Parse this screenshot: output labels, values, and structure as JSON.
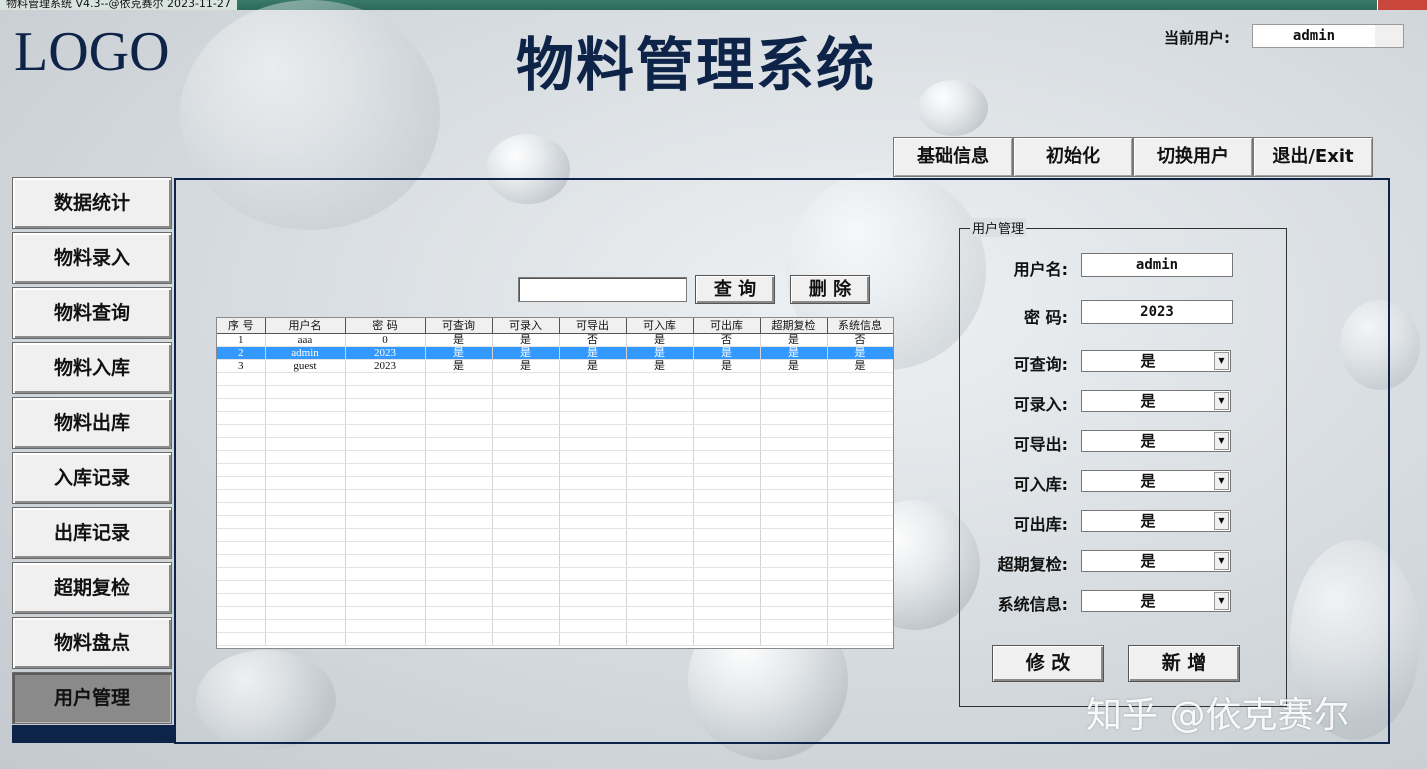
{
  "window": {
    "title": "物料管理系统 V4.3--@依克赛尔  2023-11-27"
  },
  "header": {
    "logo": "LOGO",
    "title": "物料管理系统",
    "current_user_label": "当前用户:",
    "current_user": "admin"
  },
  "top_nav": [
    {
      "label": "基础信息"
    },
    {
      "label": "初始化"
    },
    {
      "label": "切换用户"
    },
    {
      "label": "退出/Exit"
    }
  ],
  "sidebar": [
    {
      "label": "数据统计",
      "active": false
    },
    {
      "label": "物料录入",
      "active": false
    },
    {
      "label": "物料查询",
      "active": false
    },
    {
      "label": "物料入库",
      "active": false
    },
    {
      "label": "物料出库",
      "active": false
    },
    {
      "label": "入库记录",
      "active": false
    },
    {
      "label": "出库记录",
      "active": false
    },
    {
      "label": "超期复检",
      "active": false
    },
    {
      "label": "物料盘点",
      "active": false
    },
    {
      "label": "用户管理",
      "active": true
    }
  ],
  "search": {
    "value": "",
    "query_label": "查 询",
    "delete_label": "删 除"
  },
  "table": {
    "columns": [
      "序 号",
      "用户名",
      "密 码",
      "可查询",
      "可录入",
      "可导出",
      "可入库",
      "可出库",
      "超期复检",
      "系统信息"
    ],
    "rows": [
      [
        "1",
        "aaa",
        "0",
        "是",
        "是",
        "否",
        "是",
        "否",
        "是",
        "否"
      ],
      [
        "2",
        "admin",
        "2023",
        "是",
        "是",
        "是",
        "是",
        "是",
        "是",
        "是"
      ],
      [
        "3",
        "guest",
        "2023",
        "是",
        "是",
        "是",
        "是",
        "是",
        "是",
        "是"
      ]
    ],
    "selected_row": 1
  },
  "user_form": {
    "group_title": "用户管理",
    "username_label": "用户名:",
    "username": "admin",
    "password_label": "密 码:",
    "password": "2023",
    "permissions": [
      {
        "label": "可查询:",
        "value": "是"
      },
      {
        "label": "可录入:",
        "value": "是"
      },
      {
        "label": "可导出:",
        "value": "是"
      },
      {
        "label": "可入库:",
        "value": "是"
      },
      {
        "label": "可出库:",
        "value": "是"
      },
      {
        "label": "超期复检:",
        "value": "是"
      },
      {
        "label": "系统信息:",
        "value": "是"
      }
    ],
    "modify_label": "修 改",
    "add_label": "新 增"
  },
  "watermark": "知乎 @依克赛尔",
  "colors": {
    "navy": "#0d2347",
    "selection": "#3399ff",
    "button_face": "#f0f0f0",
    "active_nav": "#8a8a8a"
  }
}
